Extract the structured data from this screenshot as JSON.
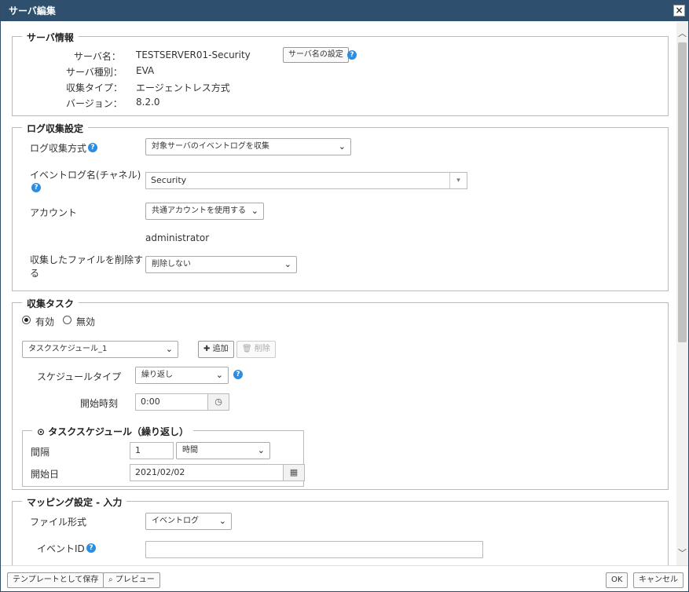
{
  "dialog": {
    "title": "サーバ編集",
    "close": "×"
  },
  "server_info": {
    "title": "サーバ情報",
    "name_label": "サーバ名：",
    "name_value": "TESTSERVER01-Security",
    "set_name_button": "サーバ名の設定",
    "type_label": "サーバ種別：",
    "type_value": "EVA",
    "collect_type_label": "収集タイプ：",
    "collect_type_value": "エージェントレス方式",
    "version_label": "バージョン：",
    "version_value": "8.2.0"
  },
  "log_settings": {
    "title": "ログ収集設定",
    "method_label": "ログ収集方式",
    "method_value": "対象サーバのイベントログを収集",
    "eventlog_label": "イベントログ名(チャネル)",
    "eventlog_value": "Security",
    "account_label": "アカウント",
    "account_value": "共通アカウントを使用する",
    "account_user": "administrator",
    "delete_label_line1": "収集したファイルを削除す",
    "delete_label_line2": "る",
    "delete_value": "削除しない"
  },
  "tasks": {
    "title": "収集タスク",
    "enabled_label": "有効",
    "disabled_label": "無効",
    "schedule_select": "タスクスケジュール_1",
    "add_button": "追加",
    "delete_button": "削除",
    "schedule_type_label": "スケジュールタイプ",
    "schedule_type_value": "繰り返し",
    "start_time_label": "開始時刻",
    "start_time_value": "0:00",
    "sub": {
      "title": "タスクスケジュール（繰り返し）",
      "interval_label": "間隔",
      "interval_value": "1",
      "interval_unit": "時間",
      "start_date_label": "開始日",
      "start_date_value": "2021/02/02"
    }
  },
  "mapping": {
    "title": "マッピング設定 - 入力",
    "file_format_label": "ファイル形式",
    "file_format_value": "イベントログ",
    "event_id_label": "イベントID",
    "event_id_value": ""
  },
  "footer": {
    "save_template": "テンプレートとして保存",
    "preview": "プレビュー",
    "ok": "OK",
    "cancel": "キャンセル"
  },
  "icons": {
    "help": "question-circle-icon",
    "chevron": "chevron-down-icon",
    "clock": "clock-icon",
    "calendar": "calendar-icon"
  },
  "colors": {
    "titlebar": "#2f4f6f",
    "help_icon": "#2b8ee0"
  }
}
